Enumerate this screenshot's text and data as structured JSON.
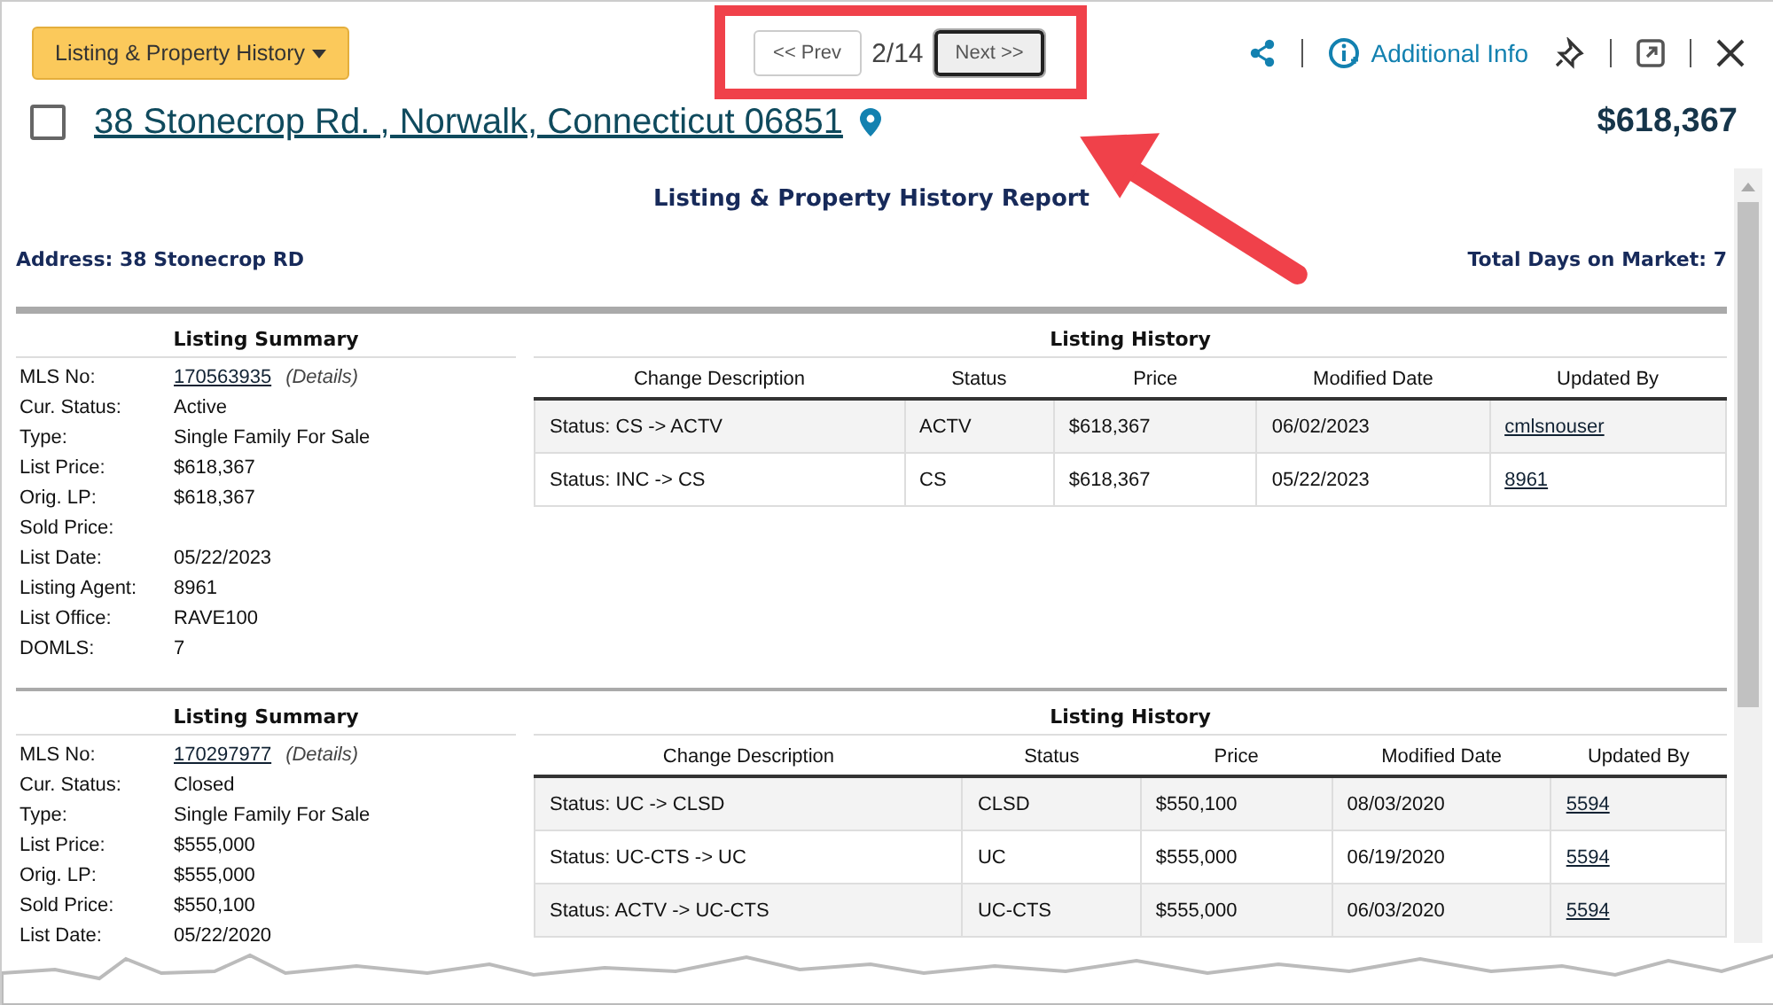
{
  "header": {
    "view_menu": "Listing & Property History",
    "pager": {
      "prev": "<< Prev",
      "position": "2/14",
      "next": "Next >>",
      "next_focused": true
    },
    "additional_info": "Additional Info"
  },
  "listing": {
    "selected": false,
    "address": "38 Stonecrop Rd. , Norwalk, Connecticut 06851",
    "price": "$618,367"
  },
  "report": {
    "title": "Listing & Property History Report",
    "address": "Address: 38 Stonecrop RD",
    "days_on_market": "Total Days on Market: 7",
    "sections": [
      {
        "summary_title": "Listing Summary",
        "summary": [
          {
            "label": "MLS No:",
            "value": "170563935",
            "kind": "link",
            "note": "(Details)"
          },
          {
            "label": "Cur. Status:",
            "value": "Active"
          },
          {
            "label": "Type:",
            "value": "Single Family For Sale"
          },
          {
            "label": "List Price:",
            "value": "$618,367"
          },
          {
            "label": "Orig. LP:",
            "value": "$618,367"
          },
          {
            "label": "Sold Price:"
          },
          {
            "label": "List Date:",
            "value": "05/22/2023"
          },
          {
            "label": "Listing Agent:",
            "value": "8961"
          },
          {
            "label": "List Office:",
            "value": "RAVE100"
          },
          {
            "label": "DOMLS:",
            "value": "7"
          }
        ],
        "history_title": "Listing History",
        "columns": [
          "Change Description",
          "Status",
          "Price",
          "Modified Date",
          "Updated By"
        ],
        "rows": [
          [
            "Status: CS -> ACTV",
            "ACTV",
            "$618,367",
            "06/02/2023",
            "cmlsnouser"
          ],
          [
            "Status: INC -> CS",
            "CS",
            "$618,367",
            "05/22/2023",
            "8961"
          ]
        ]
      },
      {
        "summary_title": "Listing Summary",
        "summary": [
          {
            "label": "MLS No:",
            "value": "170297977",
            "kind": "link",
            "note": "(Details)"
          },
          {
            "label": "Cur. Status:",
            "value": "Closed"
          },
          {
            "label": "Type:",
            "value": "Single Family For Sale"
          },
          {
            "label": "List Price:",
            "value": "$555,000"
          },
          {
            "label": "Orig. LP:",
            "value": "$555,000"
          },
          {
            "label": "Sold Price:",
            "value": "$550,100"
          },
          {
            "label": "List Date:",
            "value": "05/22/2020"
          }
        ],
        "history_title": "Listing History",
        "columns": [
          "Change Description",
          "Status",
          "Price",
          "Modified Date",
          "Updated By"
        ],
        "rows": [
          [
            "Status: UC -> CLSD",
            "CLSD",
            "$550,100",
            "08/03/2020",
            "5594"
          ],
          [
            "Status: UC-CTS -> UC",
            "UC",
            "$555,000",
            "06/19/2020",
            "5594"
          ],
          [
            "Status: ACTV -> UC-CTS",
            "UC-CTS",
            "$555,000",
            "06/03/2020",
            "5594"
          ]
        ]
      }
    ]
  }
}
